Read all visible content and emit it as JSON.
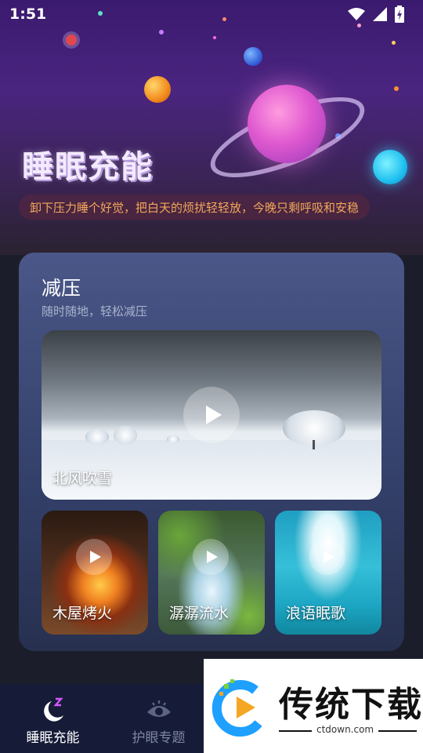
{
  "status_bar": {
    "time": "1:51",
    "icons": [
      "wifi-icon",
      "signal-icon",
      "battery-charging-icon"
    ]
  },
  "hero": {
    "title": "睡眠充能",
    "subtitle": "卸下压力睡个好觉，把白天的烦扰轻轻放，今晚只剩呼吸和安稳"
  },
  "section": {
    "title": "减压",
    "subtitle": "随时随地，轻松减压",
    "featured": {
      "label": "北风吹雪",
      "icon": "play-icon"
    },
    "items": [
      {
        "label": "木屋烤火",
        "icon": "play-icon"
      },
      {
        "label": "潺潺流水",
        "icon": "play-icon"
      },
      {
        "label": "浪语眠歌",
        "icon": "play-icon"
      }
    ]
  },
  "bottom_nav": {
    "items": [
      {
        "label": "睡眠充能",
        "icon": "moon-z-icon",
        "active": true
      },
      {
        "label": "护眼专题",
        "icon": "eye-icon",
        "active": false
      }
    ]
  },
  "watermark": {
    "text": "传统下载",
    "url": "ctdown.com"
  },
  "colors": {
    "hero_subtitle": "#f2a75a",
    "nav_bg": "#161c38",
    "nav_inactive": "#7d86a3"
  }
}
